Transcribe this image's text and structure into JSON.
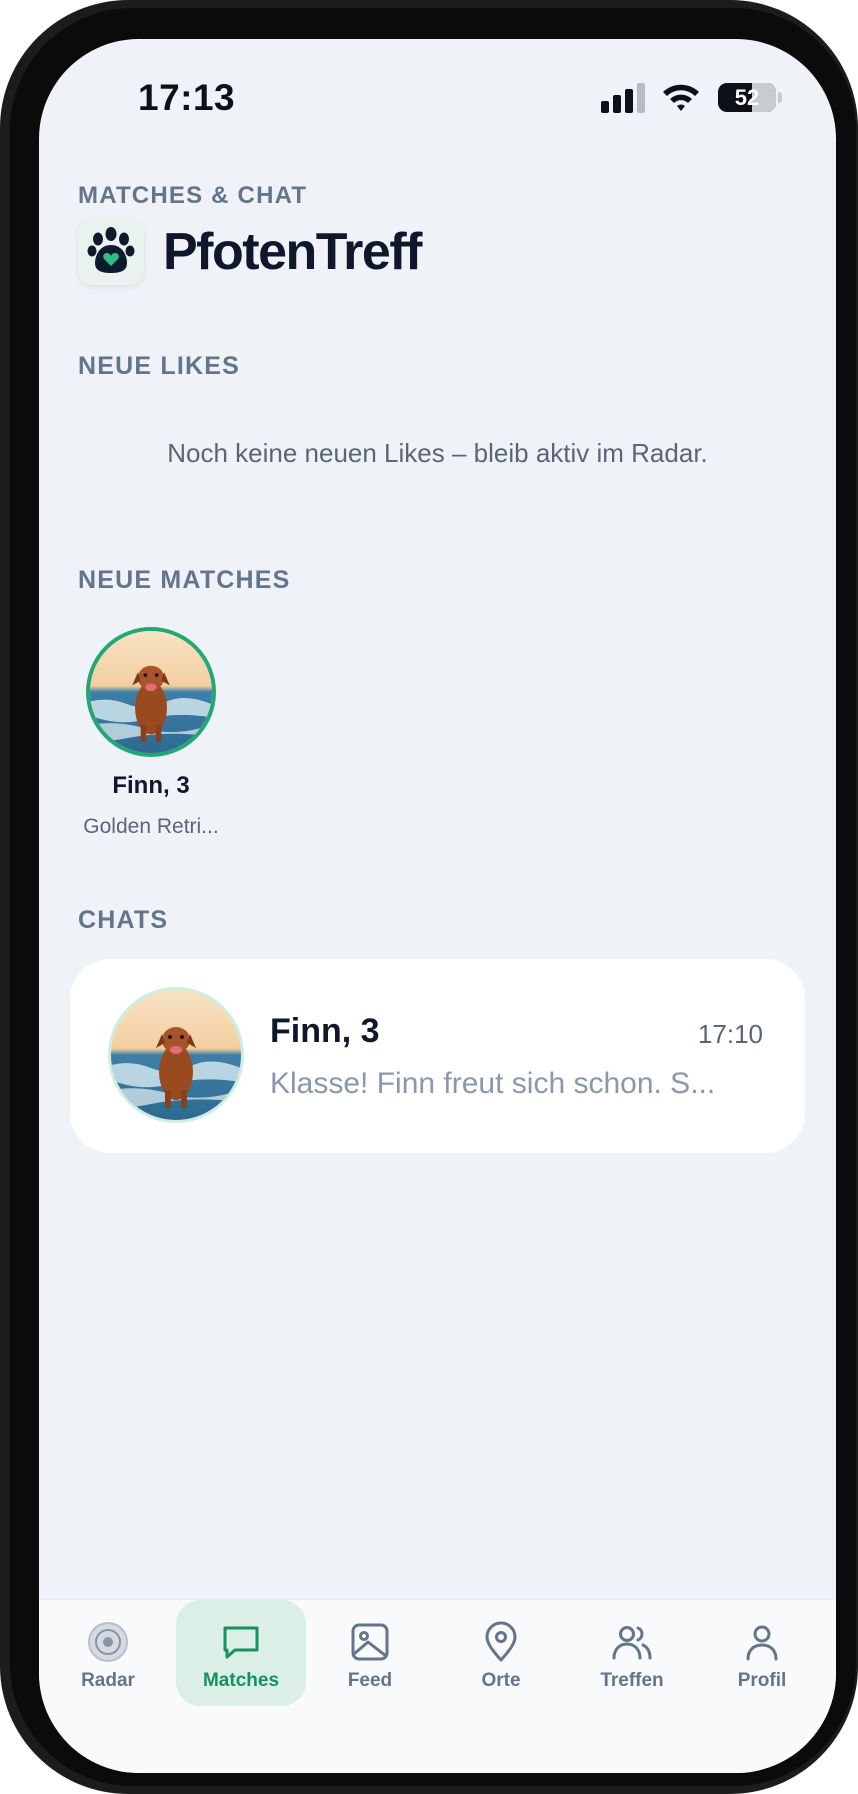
{
  "status_bar": {
    "time": "17:13",
    "battery": "52"
  },
  "header": {
    "eyebrow": "MATCHES & CHAT",
    "app_name": "PfotenTreff"
  },
  "likes": {
    "label": "NEUE LIKES",
    "empty_text": "Noch keine neuen Likes – bleib aktiv im Radar."
  },
  "matches": {
    "label": "NEUE MATCHES",
    "items": [
      {
        "name": "Finn, 3",
        "breed": "Golden Retri..."
      }
    ]
  },
  "chats": {
    "label": "CHATS",
    "items": [
      {
        "name": "Finn, 3",
        "time": "17:10",
        "preview": "Klasse! Finn freut sich schon. S..."
      }
    ]
  },
  "nav": {
    "active": "Matches",
    "items": [
      {
        "label": "Radar",
        "icon": "radar-icon"
      },
      {
        "label": "Matches",
        "icon": "chat-icon"
      },
      {
        "label": "Feed",
        "icon": "image-icon"
      },
      {
        "label": "Orte",
        "icon": "location-pin-icon"
      },
      {
        "label": "Treffen",
        "icon": "people-icon"
      },
      {
        "label": "Profil",
        "icon": "person-icon"
      }
    ]
  },
  "colors": {
    "accent": "#16915f",
    "match_ring": "#22a874",
    "background": "#eff3f8"
  }
}
